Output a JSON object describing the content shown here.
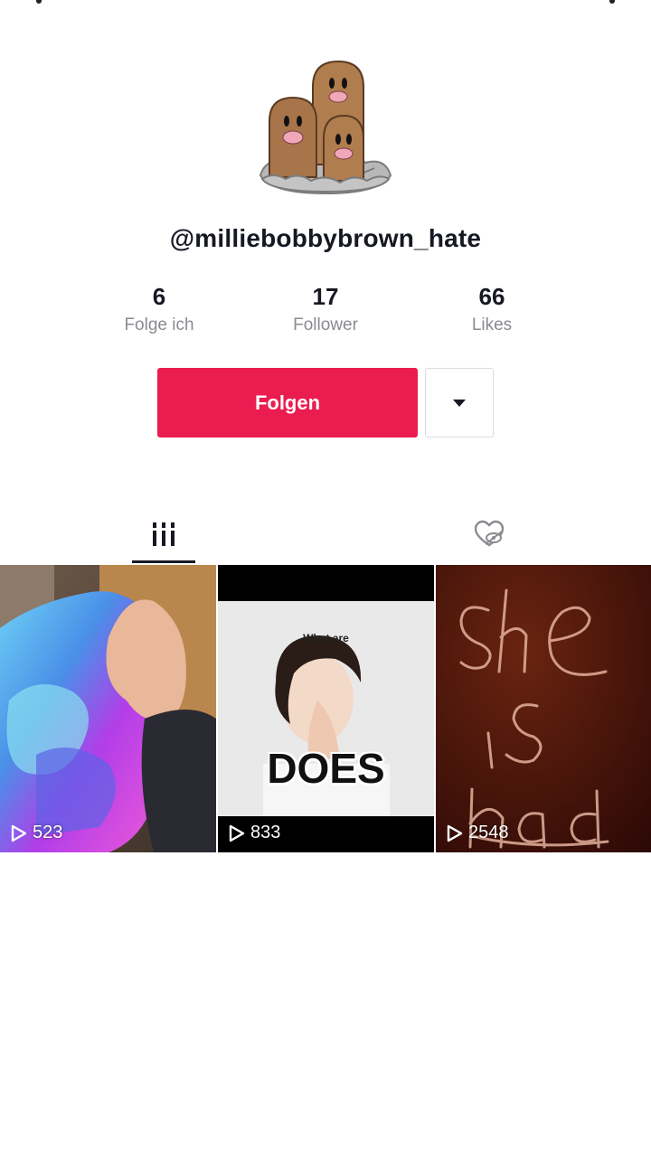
{
  "profile": {
    "username": "@milliebobbybrown_hate",
    "avatar_icon": "diglett-trio-avatar"
  },
  "stats": [
    {
      "value": "6",
      "label": "Folge ich"
    },
    {
      "value": "17",
      "label": "Follower"
    },
    {
      "value": "66",
      "label": "Likes"
    }
  ],
  "actions": {
    "follow_label": "Folgen",
    "more_icon": "caret-down-icon"
  },
  "tabs": [
    {
      "name": "videos-grid",
      "icon": "grid-icon",
      "selected": true
    },
    {
      "name": "liked-videos",
      "icon": "heart-hidden-icon",
      "selected": false
    }
  ],
  "videos": [
    {
      "views": "523"
    },
    {
      "views": "833",
      "caption_small": "What are",
      "caption_big": "DOES"
    },
    {
      "views": "2548"
    }
  ],
  "colors": {
    "accent": "#ea1c50",
    "text": "#161823",
    "muted": "#8a8b91"
  }
}
